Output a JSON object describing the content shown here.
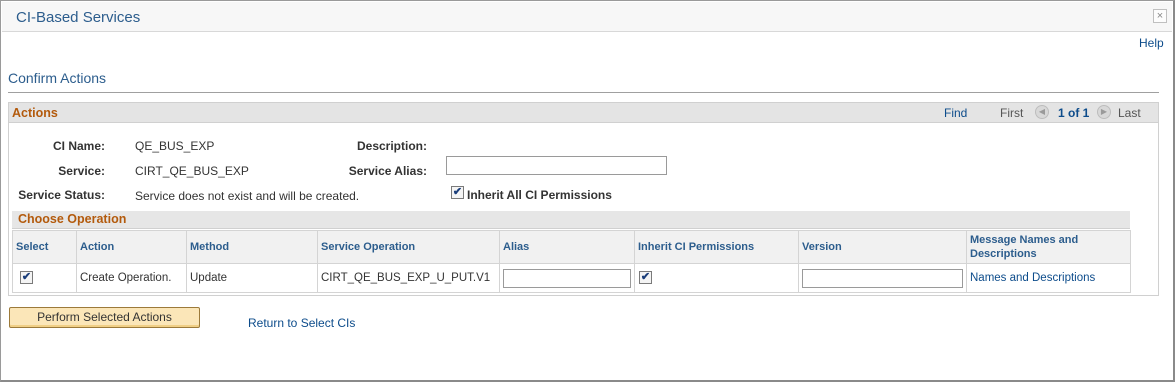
{
  "window": {
    "title": "CI-Based Services",
    "faint_text": "…………",
    "close_glyph": "×"
  },
  "help_label": "Help",
  "page_title": "Confirm Actions",
  "actions": {
    "title": "Actions",
    "nav": {
      "find": "Find",
      "first": "First",
      "count": "1 of 1",
      "last": "Last",
      "prev_glyph": "◀",
      "next_glyph": "▶"
    },
    "fields": {
      "ci_name_label": "CI Name:",
      "ci_name_value": "QE_BUS_EXP",
      "service_label": "Service:",
      "service_value": "CIRT_QE_BUS_EXP",
      "status_label": "Service Status:",
      "status_value": "Service does not exist and will be created.",
      "description_label": "Description:",
      "alias_label": "Service Alias:",
      "alias_value": "",
      "inherit_all_label": "Inherit All CI Permissions",
      "inherit_all_checked": true
    }
  },
  "choose_operation": {
    "title": "Choose Operation",
    "columns": [
      "Select",
      "Action",
      "Method",
      "Service Operation",
      "Alias",
      "Inherit CI Permissions",
      "Version",
      "Message Names and Descriptions"
    ],
    "rows": [
      {
        "select": true,
        "action": "Create Operation.",
        "method": "Update",
        "service_operation": "CIRT_QE_BUS_EXP_U_PUT.V1",
        "alias": "",
        "inherit": true,
        "version": "",
        "message_link": "Names and Descriptions"
      }
    ]
  },
  "buttons": {
    "perform": "Perform Selected Actions",
    "return": "Return to Select CIs"
  },
  "check_glyph": "✔"
}
